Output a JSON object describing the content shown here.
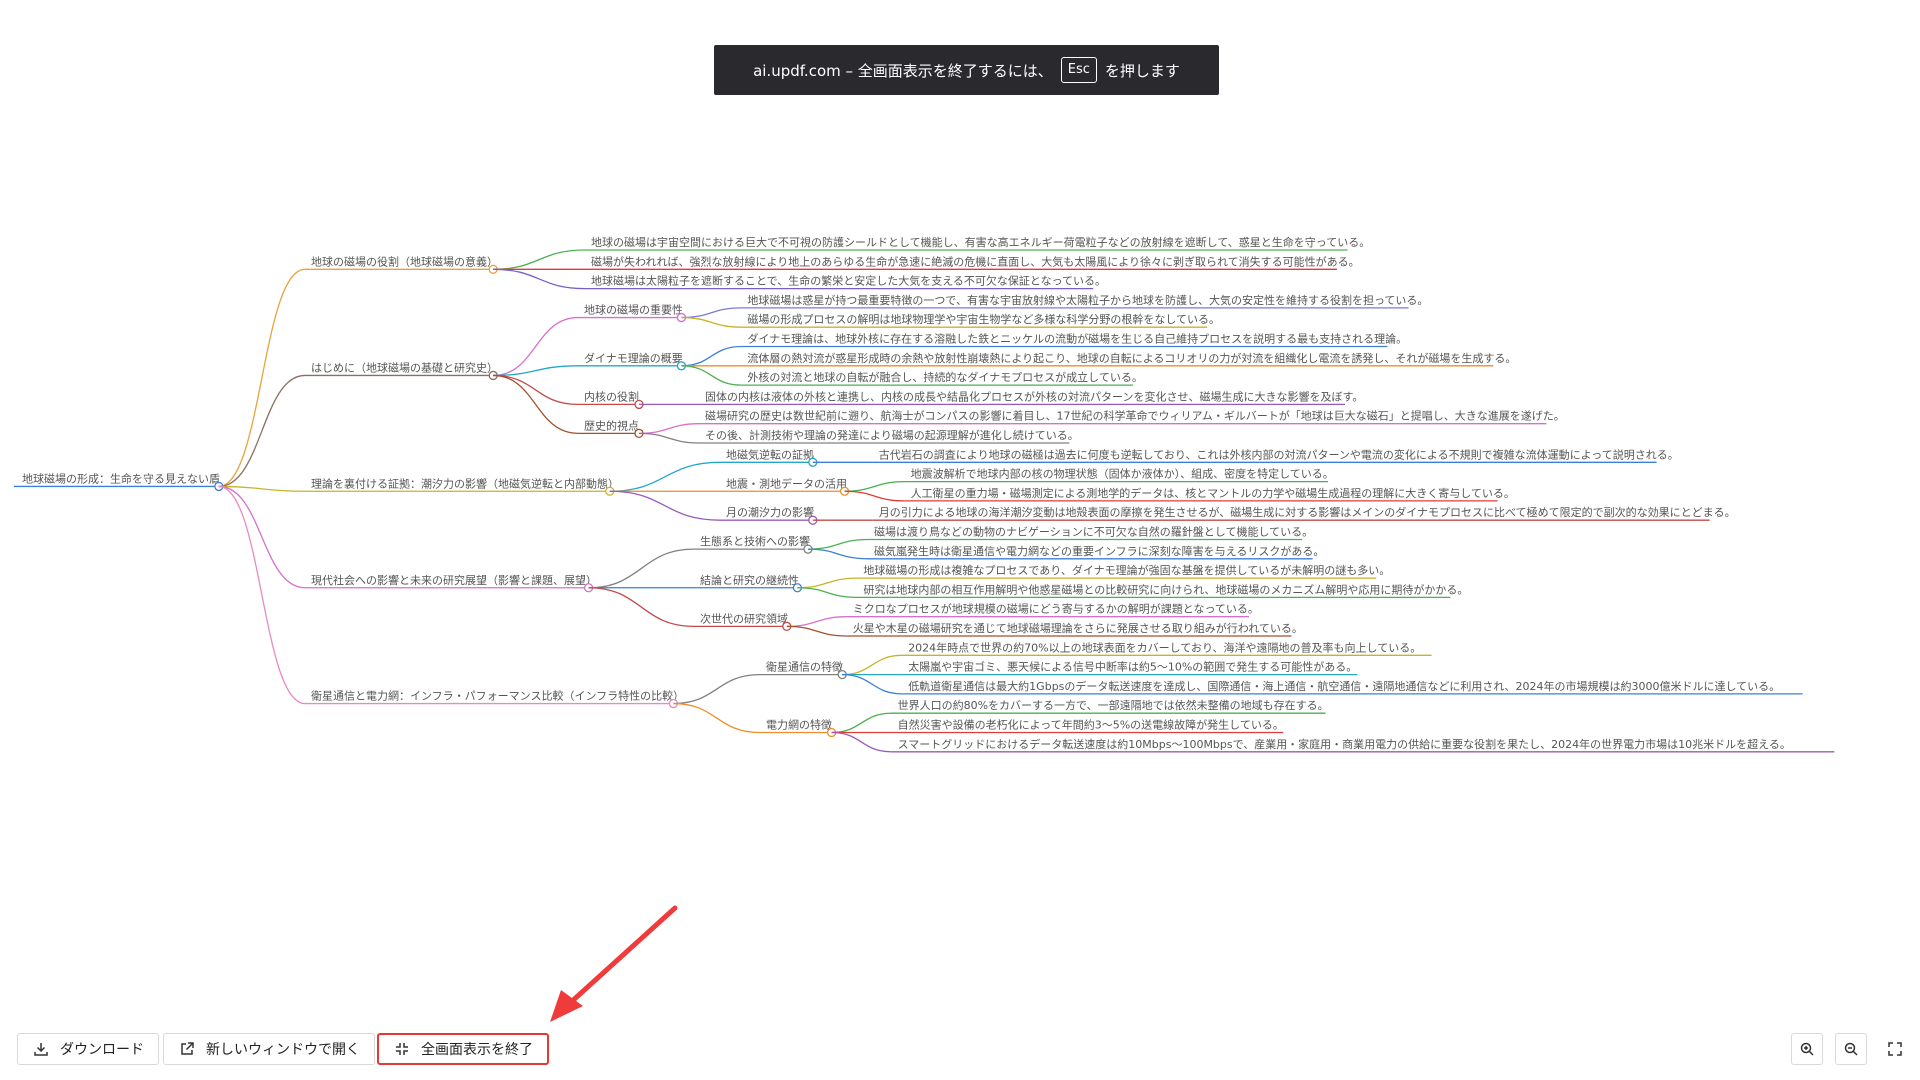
{
  "banner": {
    "prefix": "ai.updf.com – 全画面表示を終了するには、",
    "key": "Esc",
    "suffix": "を押します"
  },
  "toolbar": {
    "download_label": "ダウンロード",
    "open_window_label": "新しいウィンドウで開く",
    "exit_fullscreen_label": "全画面表示を終了"
  },
  "icons": {
    "download": "download-icon",
    "open_window": "external-link-icon",
    "exit_fullscreen": "collapse-icon",
    "zoom_in": "zoom-in-icon",
    "zoom_out": "zoom-out-icon",
    "fullscreen": "expand-icon"
  },
  "mindmap": {
    "root": "地球磁場の形成：生命を守る見えない盾",
    "branches": [
      {
        "label": "地球の磁場の役割（地球磁場の意義）",
        "color": "#e8a33d",
        "children": [
          {
            "label": "地球の磁場は宇宙空間における巨大で不可視の防護シールドとして機能し、有害な高エネルギー荷電粒子などの放射線を遮断して、惑星と生命を守っている。",
            "color": "#4caf50"
          },
          {
            "label": "磁場が失われれば、強烈な放射線により地上のあらゆる生命が急速に絶滅の危機に直面し、大気も太陽風により徐々に剥ぎ取られて消失する可能性がある。",
            "color": "#e53935"
          },
          {
            "label": "地球磁場は太陽粒子を遮断することで、生命の繁栄と安定した大気を支える不可欠な保証となっている。",
            "color": "#7b5cc9"
          }
        ]
      },
      {
        "label": "はじめに（地球磁場の基礎と研究史）",
        "color": "#8d6e63",
        "children": [
          {
            "label": "地球の磁場の重要性",
            "color": "#d670c8",
            "children": [
              {
                "label": "地球磁場は惑星が持つ最重要特徴の一つで、有害な宇宙放射線や太陽粒子から地球を防護し、大気の安定性を維持する役割を担っている。",
                "color": "#7a7ad9"
              },
              {
                "label": "磁場の形成プロセスの解明は地球物理学や宇宙生物学など多様な科学分野の根幹をなしている。",
                "color": "#c9b22a"
              }
            ]
          },
          {
            "label": "ダイナモ理論の概要",
            "color": "#26a6c9",
            "children": [
              {
                "label": "ダイナモ理論は、地球外核に存在する溶融した鉄とニッケルの流動が磁場を生じる自己維持プロセスを説明する最も支持される理論。",
                "color": "#3d7fd6"
              },
              {
                "label": "流体層の熱対流が惑星形成時の余熱や放射性崩壊熱により起こり、地球の自転によるコリオリの力が対流を組織化し電流を誘発し、それが磁場を生成する。",
                "color": "#ef8c2b"
              },
              {
                "label": "外核の対流と地球の自転が融合し、持続的なダイナモプロセスが成立している。",
                "color": "#4caf50"
              }
            ]
          },
          {
            "label": "内核の役割",
            "color": "#c24a4a",
            "children": [
              {
                "label": "固体の内核は液体の外核と連携し、内核の成長や結晶化プロセスが外核の対流パターンを変化させ、磁場生成に大きな影響を及ぼす。",
                "color": "#9b59b6"
              }
            ]
          },
          {
            "label": "歴史的視点",
            "color": "#a0522d",
            "children": [
              {
                "label": "磁場研究の歴史は数世紀前に遡り、航海士がコンパスの影響に着目し、17世紀の科学革命でウィリアム・ギルバートが「地球は巨大な磁石」と提唱し、大きな進展を遂げた。",
                "color": "#d670c8"
              },
              {
                "label": "その後、計測技術や理論の発達により磁場の起源理解が進化し続けている。",
                "color": "#808080"
              }
            ]
          }
        ]
      },
      {
        "label": "理論を裏付ける証拠：潮汐力の影響（地磁気逆転と内部動態）",
        "color": "#c9b22a",
        "children": [
          {
            "label": "地磁気逆転の証拠",
            "color": "#26a6c9",
            "children": [
              {
                "label": "古代岩石の調査により地球の磁極は過去に何度も逆転しており、これは外核内部の対流パターンや電流の変化による不規則で複雑な流体運動によって説明される。",
                "color": "#3d7fd6"
              }
            ]
          },
          {
            "label": "地震・測地データの活用",
            "color": "#ef8c2b",
            "children": [
              {
                "label": "地震波解析で地球内部の核の物理状態（固体か液体か）、組成、密度を特定している。",
                "color": "#4caf50"
              },
              {
                "label": "人工衛星の重力場・磁場測定による測地学的データは、核とマントルの力学や磁場生成過程の理解に大きく寄与している。",
                "color": "#e53935"
              }
            ]
          },
          {
            "label": "月の潮汐力の影響",
            "color": "#9b59b6",
            "children": [
              {
                "label": "月の引力による地球の海洋潮汐変動は地殻表面の摩擦を発生させるが、磁場生成に対する影響はメインのダイナモプロセスに比べて極めて限定的で副次的な効果にとどまる。",
                "color": "#c24a4a"
              }
            ]
          }
        ]
      },
      {
        "label": "現代社会への影響と未来の研究展望（影響と課題、展望）",
        "color": "#d670c8",
        "children": [
          {
            "label": "生態系と技術への影響",
            "color": "#808080",
            "children": [
              {
                "label": "磁場は渡り鳥などの動物のナビゲーションに不可欠な自然の羅針盤として機能している。",
                "color": "#4caf50"
              },
              {
                "label": "磁気嵐発生時は衛星通信や電力網などの重要インフラに深刻な障害を与えるリスクがある。",
                "color": "#3d7fd6"
              }
            ]
          },
          {
            "label": "結論と研究の継続性",
            "color": "#3d7fd6",
            "children": [
              {
                "label": "地球磁場の形成は複雑なプロセスであり、ダイナモ理論が強固な基盤を提供しているが未解明の謎も多い。",
                "color": "#c9b22a"
              },
              {
                "label": "研究は地球内部の相互作用解明や他惑星磁場との比較研究に向けられ、地球磁場のメカニズム解明や応用に期待がかかる。",
                "color": "#4caf50"
              }
            ]
          },
          {
            "label": "次世代の研究領域",
            "color": "#c24a4a",
            "children": [
              {
                "label": "ミクロなプロセスが地球規模の磁場にどう寄与するかの解明が課題となっている。",
                "color": "#d670c8"
              },
              {
                "label": "火星や木星の磁場研究を通じて地球磁場理論をさらに発展させる取り組みが行われている。",
                "color": "#a0522d"
              }
            ]
          }
        ]
      },
      {
        "label": "衛星通信と電力網：インフラ・パフォーマンス比較（インフラ特性の比較）",
        "color": "#e78ac3",
        "children": [
          {
            "label": "衛星通信の特徴",
            "color": "#808080",
            "children": [
              {
                "label": "2024年時点で世界の約70%以上の地球表面をカバーしており、海洋や遠隔地の普及率も向上している。",
                "color": "#c9b22a"
              },
              {
                "label": "太陽嵐や宇宙ゴミ、悪天候による信号中断率は約5～10%の範囲で発生する可能性がある。",
                "color": "#26a6c9"
              },
              {
                "label": "低軌道衛星通信は最大約1Gbpsのデータ転送速度を達成し、国際通信・海上通信・航空通信・遠隔地通信などに利用され、2024年の市場規模は約3000億米ドルに達している。",
                "color": "#3d7fd6"
              }
            ]
          },
          {
            "label": "電力網の特徴",
            "color": "#ef8c2b",
            "children": [
              {
                "label": "世界人口の約80%をカバーする一方で、一部遠隔地では依然未整備の地域も存在する。",
                "color": "#4caf50"
              },
              {
                "label": "自然災害や設備の老朽化によって年間約3～5%の送電線故障が発生している。",
                "color": "#e53935"
              },
              {
                "label": "スマートグリッドにおけるデータ転送速度は約10Mbps～100Mbpsで、産業用・家庭用・商業用電力の供給に重要な役割を果たし、2024年の世界電力市場は10兆米ドルを超える。",
                "color": "#9b59b6"
              }
            ]
          }
        ]
      }
    ]
  }
}
